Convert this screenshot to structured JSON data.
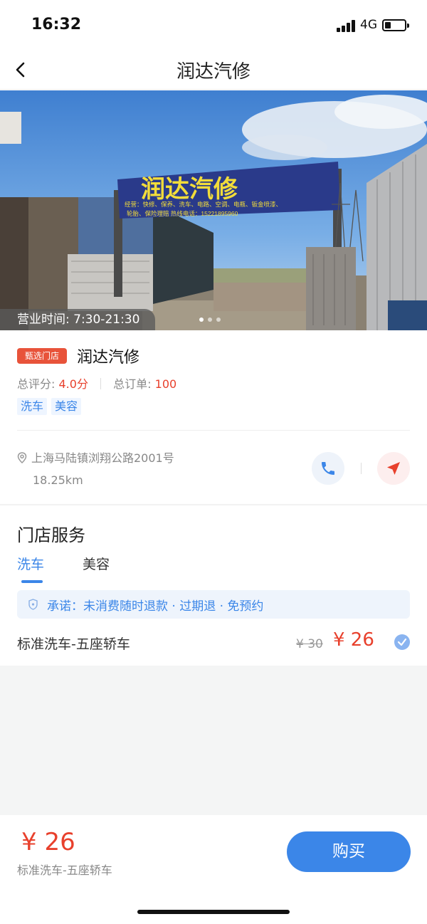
{
  "status_bar": {
    "time": "16:32",
    "network": "4G"
  },
  "nav": {
    "title": "润达汽修",
    "back_icon": "chevron-left-icon"
  },
  "hero": {
    "sign_text": "润达汽修",
    "sign_subtext_1": "经营：快修、保养、洗车、电路、空调、电瓶、钣金喷漆、",
    "sign_subtext_2": "轮胎、保险理赔    热线电话：15221895960",
    "hours": "营业时间: 7:30-21:30",
    "carousel_count": 3,
    "carousel_active": 0
  },
  "store": {
    "badge": "甄选门店",
    "name": "润达汽修",
    "rating_label": "总评分:",
    "rating_value": "4.0分",
    "orders_label": "总订单:",
    "orders_value": "100",
    "tags": [
      "洗车",
      "美容"
    ],
    "address": "上海马陆镇浏翔公路2001号",
    "distance": "18.25km"
  },
  "services": {
    "title": "门店服务",
    "tabs": [
      {
        "label": "洗车",
        "active": true
      },
      {
        "label": "美容",
        "active": false
      }
    ],
    "promise": "承诺：未消费随时退款 · 过期退 · 免预约",
    "items": [
      {
        "name": "标准洗车-五座轿车",
        "old_price": "¥ 30",
        "price": "¥ 26",
        "selected": true
      }
    ]
  },
  "bottom": {
    "price": "¥ 26",
    "item": "标准洗车-五座轿车",
    "buy_label": "购买"
  },
  "colors": {
    "accent": "#3b86e8",
    "price_red": "#e8402c",
    "badge_red": "#e8533a"
  }
}
